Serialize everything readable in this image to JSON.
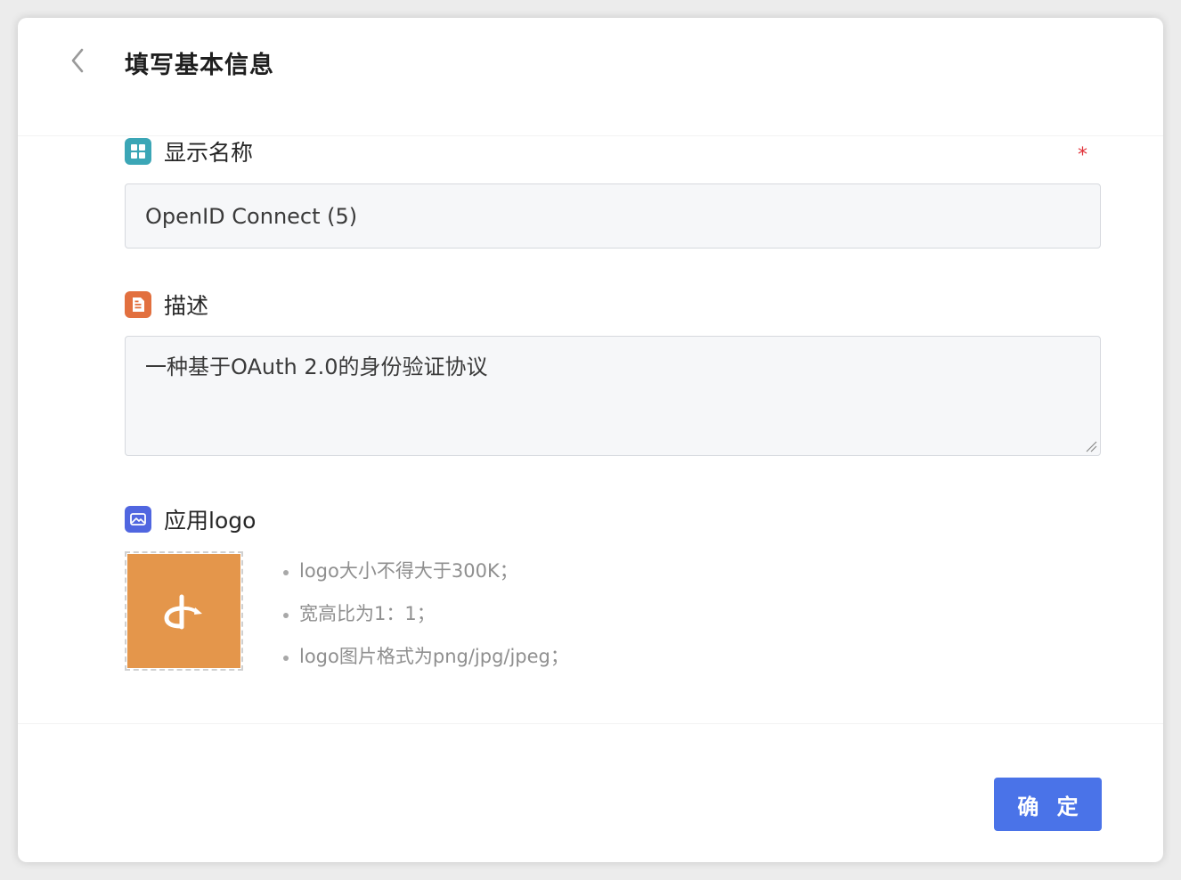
{
  "header": {
    "title": "填写基本信息",
    "back_icon": "chevron-left-icon"
  },
  "display_name": {
    "label": "显示名称",
    "icon": "grid-icon",
    "icon_color": "#3ba6b6",
    "required_mark": "*",
    "value": "OpenID Connect (5)"
  },
  "description": {
    "label": "描述",
    "icon": "document-icon",
    "icon_color": "#e2703f",
    "value": "一种基于OAuth 2.0的身份验证协议"
  },
  "app_logo": {
    "label": "应用logo",
    "icon": "image-icon",
    "icon_color": "#5066e0",
    "logo_icon": "openid-logo-icon",
    "logo_bg_color": "#e4964b",
    "tips": [
      "logo大小不得大于300K；",
      "宽高比为1：1；",
      "logo图片格式为png/jpg/jpeg；"
    ]
  },
  "footer": {
    "confirm_label": "确 定",
    "confirm_color": "#4a73e8"
  }
}
